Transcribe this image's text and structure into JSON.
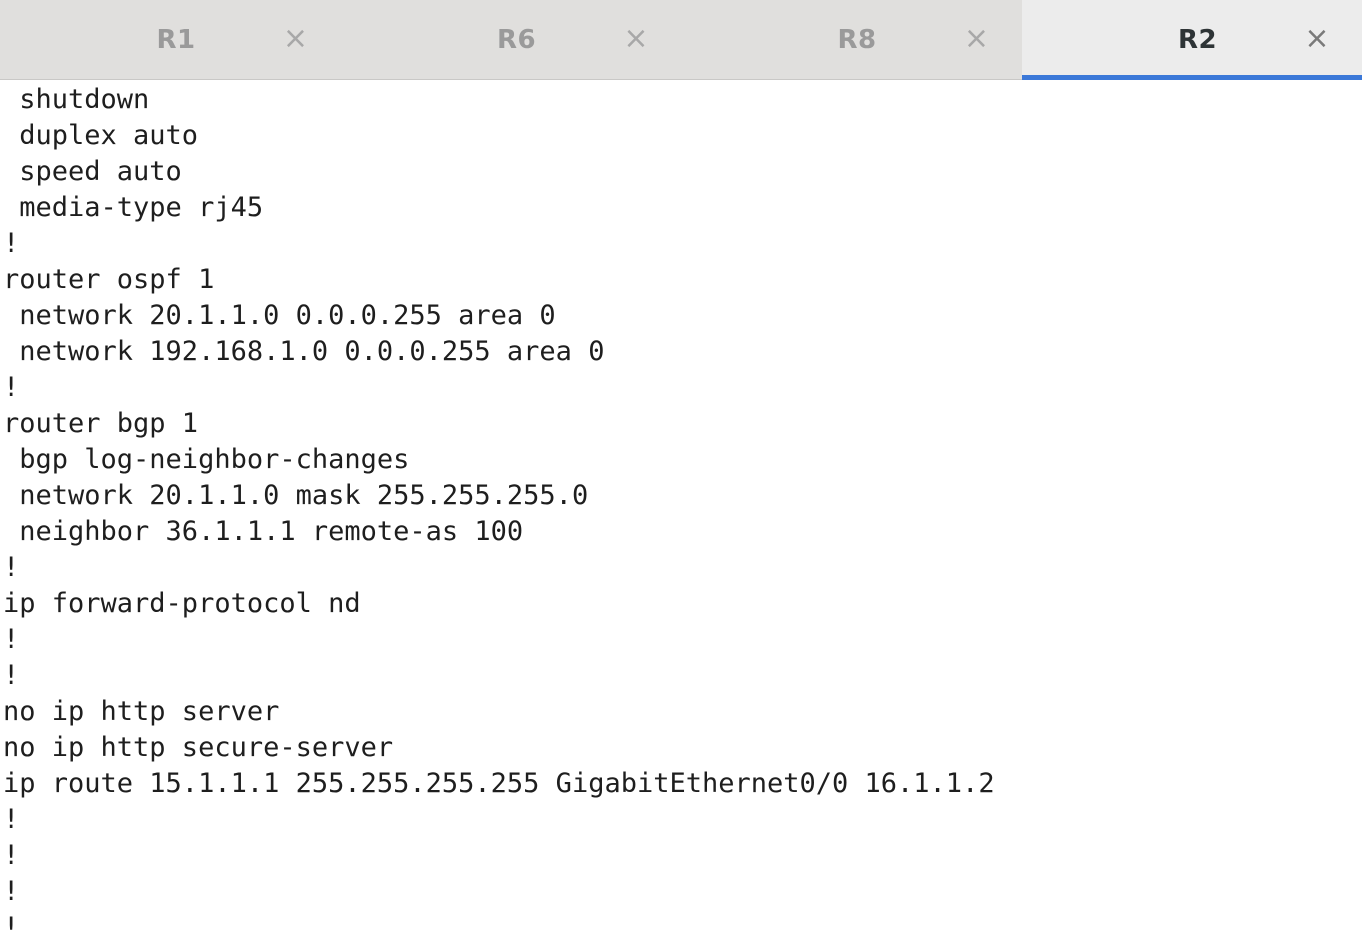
{
  "tabs": [
    {
      "label": "R1",
      "close": "×",
      "active": false
    },
    {
      "label": "R6",
      "close": "×",
      "active": false
    },
    {
      "label": "R8",
      "close": "×",
      "active": false
    },
    {
      "label": "R2",
      "close": "×",
      "active": true
    }
  ],
  "terminal": {
    "lines": [
      " shutdown",
      " duplex auto",
      " speed auto",
      " media-type rj45",
      "!",
      "router ospf 1",
      " network 20.1.1.0 0.0.0.255 area 0",
      " network 192.168.1.0 0.0.0.255 area 0",
      "!",
      "router bgp 1",
      " bgp log-neighbor-changes",
      " network 20.1.1.0 mask 255.255.255.0",
      " neighbor 36.1.1.1 remote-as 100",
      "!",
      "ip forward-protocol nd",
      "!",
      "!",
      "no ip http server",
      "no ip http secure-server",
      "ip route 15.1.1.1 255.255.255.255 GigabitEthernet0/0 16.1.1.2",
      "!",
      "!",
      "!",
      "!"
    ]
  }
}
